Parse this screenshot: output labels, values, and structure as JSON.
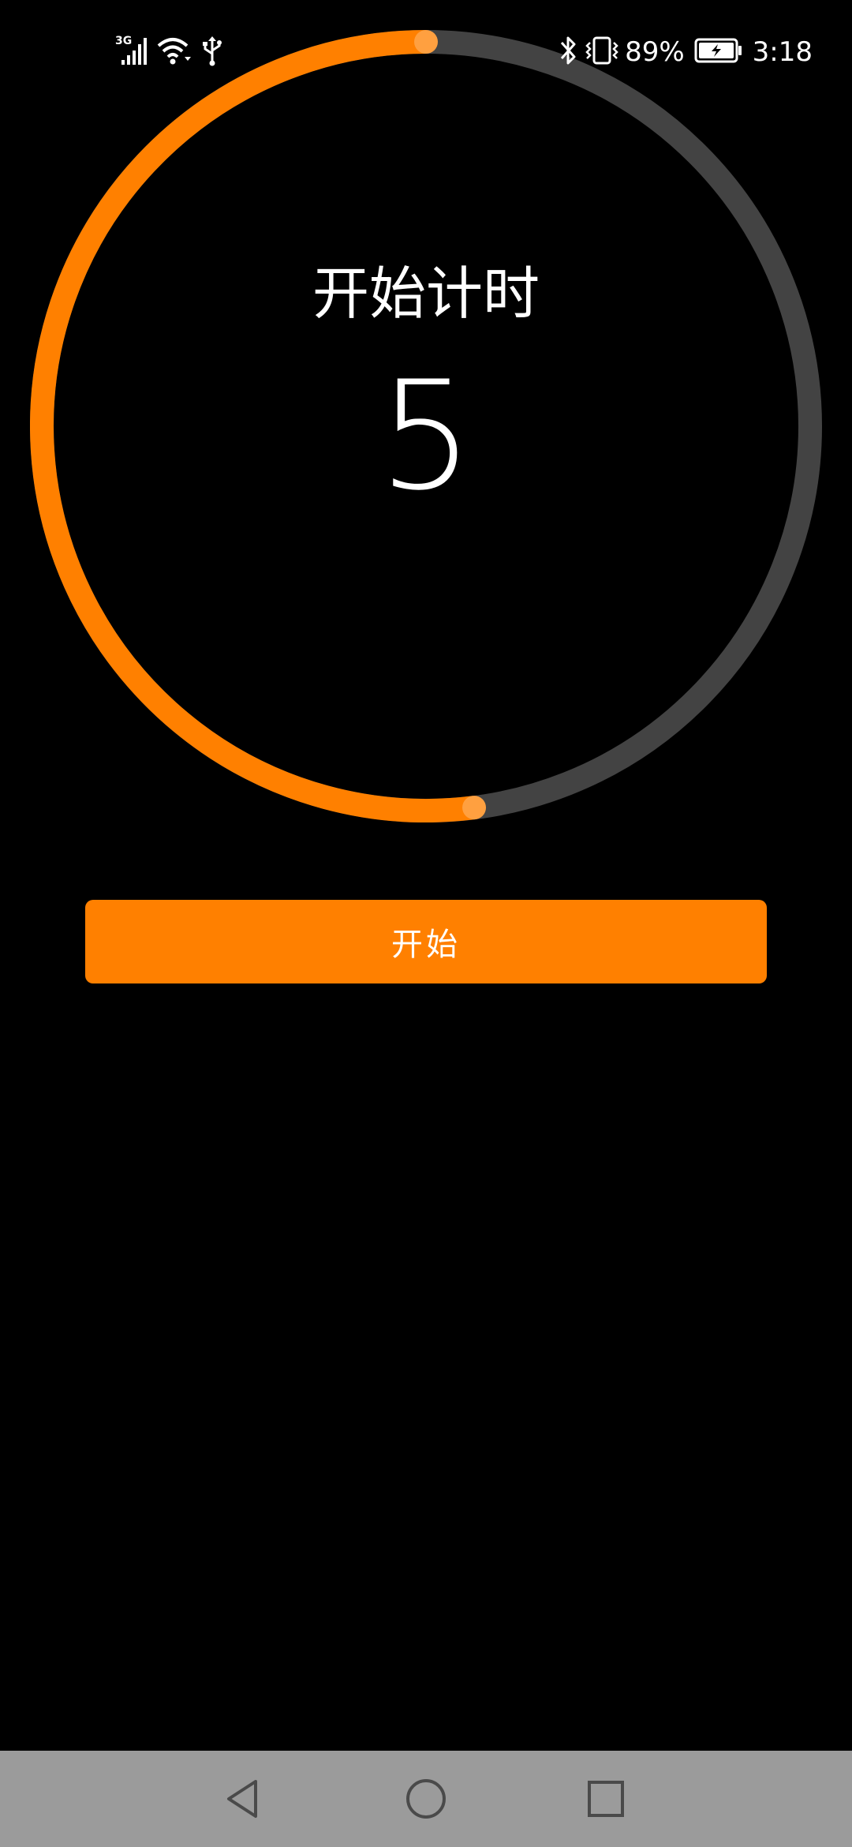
{
  "status_bar": {
    "network_type": "3G",
    "battery_percent": "89%",
    "time": "3:18",
    "icons": [
      "signal-icon",
      "wifi-icon",
      "usb-icon",
      "bluetooth-icon",
      "vibrate-icon",
      "battery-charging-icon"
    ]
  },
  "timer": {
    "title": "开始计时",
    "count": "5",
    "progress_fraction": 0.52
  },
  "start_button": {
    "label": "开始"
  },
  "nav_bar": {
    "icons": [
      "back-icon",
      "home-icon",
      "recents-icon"
    ]
  },
  "colors": {
    "accent": "#FF8000",
    "ring_track": "#434343",
    "nav_bar_bg": "#9B9B9B",
    "background": "#000000"
  }
}
